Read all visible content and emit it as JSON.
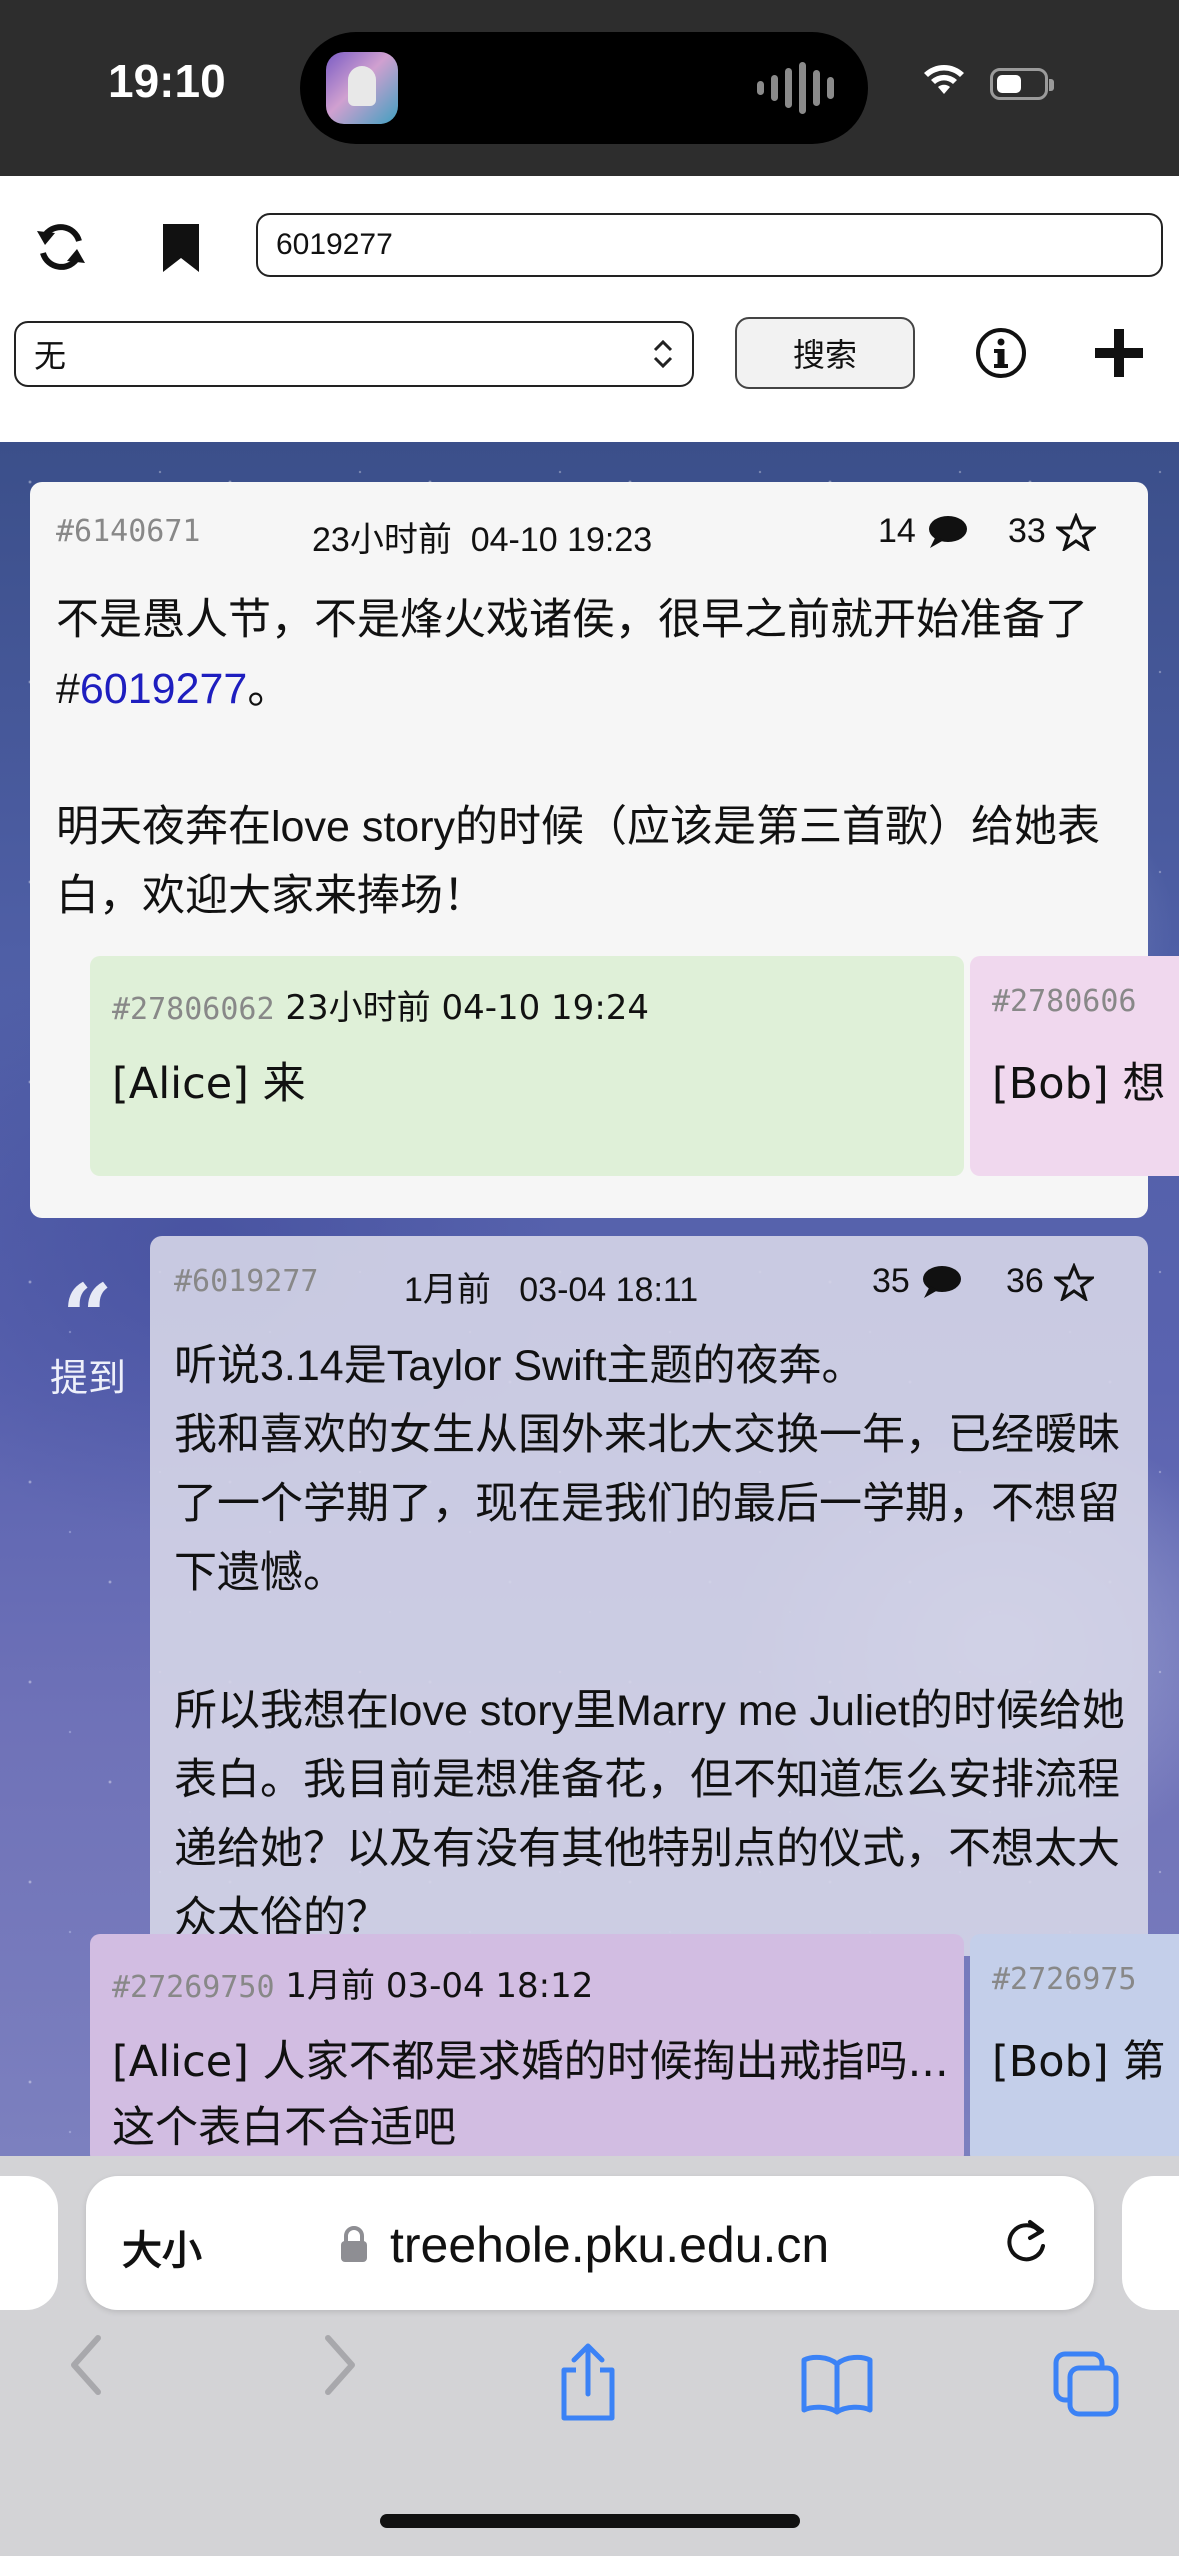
{
  "status_bar": {
    "time": "19:10"
  },
  "toolbar": {
    "search_value": "6019277",
    "filter_selected": "无",
    "search_button": "搜索"
  },
  "main_post": {
    "pid": "#6140671",
    "time": "23小时前  04-10 19:23",
    "replies": "14",
    "stars": "33",
    "text_before_link": "不是愚人节，不是烽火戏诸侯，很早之前就开始准备了#",
    "link": "6019277",
    "text_after_link": "。\n\n明天夜奔在love story的时候（应该是第三首歌）给她表白，欢迎大家来捧场！"
  },
  "main_replies": [
    {
      "pid": "#27806062",
      "time": "23小时前 04-10 19:24",
      "text": "[Alice] 来"
    },
    {
      "pid": "#2780606",
      "time": "",
      "text": "[Bob] 想"
    }
  ],
  "quote_section": {
    "mark": "“",
    "label": "提到"
  },
  "quoted_post": {
    "pid": "#6019277",
    "time": "1月前   03-04 18:11",
    "replies": "35",
    "stars": "36",
    "text": "听说3.14是Taylor Swift主题的夜奔。\n我和喜欢的女生从国外来北大交换一年，已经暧昧了一个学期了，现在是我们的最后一学期，不想留下遗憾。\n\n所以我想在love story里Marry me Juliet的时候给她表白。我目前是想准备花，但不知道怎么安排流程递给她？以及有没有其他特别点的仪式，不想太大众太俗的？"
  },
  "quoted_replies": [
    {
      "pid": "#27269750",
      "time": "1月前 03-04 18:12",
      "text": "[Alice] 人家不都是求婚的时候掏出戒指吗...这个表白不合适吧"
    },
    {
      "pid": "#2726975",
      "time": "",
      "text": "[Bob] 第"
    }
  ],
  "browser": {
    "size_label": "大小",
    "domain": "treehole.pku.edu.cn"
  },
  "colors": {
    "link": "#1e1ebf",
    "reply_green": "#dff0d8",
    "reply_pink": "#f0d8ee",
    "reply_purple": "#d2bde2",
    "reply_blue": "#c4cfea",
    "safari_blue": "#3b82f6"
  },
  "icons": [
    "refresh-icon",
    "bookmark-icon",
    "info-icon",
    "plus-icon",
    "comment-icon",
    "star-icon",
    "lock-icon",
    "reload-icon",
    "back-icon",
    "forward-icon",
    "share-icon",
    "bookmarks-icon",
    "tabs-icon"
  ]
}
